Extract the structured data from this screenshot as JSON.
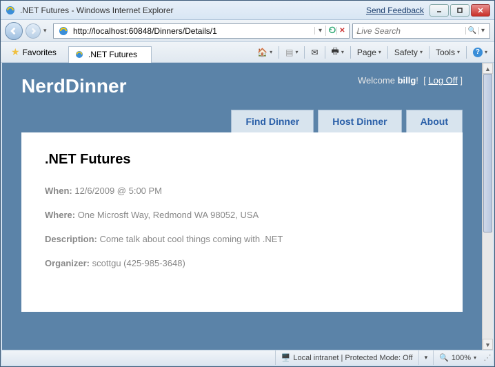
{
  "window": {
    "title": ".NET Futures - Windows Internet Explorer",
    "feedback_link": "Send Feedback"
  },
  "address_bar": {
    "url": "http://localhost:60848/Dinners/Details/1"
  },
  "search_bar": {
    "placeholder": "Live Search"
  },
  "favorites": {
    "label": "Favorites"
  },
  "tab": {
    "title": ".NET Futures"
  },
  "toolbar_menus": {
    "page": "Page",
    "safety": "Safety",
    "tools": "Tools"
  },
  "page": {
    "brand": "NerdDinner",
    "welcome_prefix": "Welcome ",
    "username": "billg",
    "logoff": "Log Off",
    "nav": {
      "find": "Find Dinner",
      "host": "Host Dinner",
      "about": "About"
    },
    "dinner": {
      "title": ".NET Futures",
      "when_label": "When:",
      "when_value": "12/6/2009 @ 5:00 PM",
      "where_label": "Where:",
      "where_value": "One Microsft Way, Redmond WA 98052, USA",
      "description_label": "Description:",
      "description_value": "Come talk about cool things coming with .NET",
      "organizer_label": "Organizer:",
      "organizer_value": "scottgu (425-985-3648)"
    }
  },
  "status": {
    "zone": "Local intranet | Protected Mode: Off",
    "zoom": "100%"
  }
}
